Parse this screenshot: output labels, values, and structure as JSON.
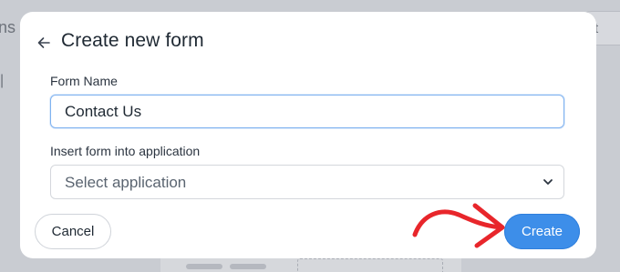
{
  "background": {
    "left_fragment": "ns",
    "pipe": "|",
    "right_fragment": "rt"
  },
  "modal": {
    "title": "Create new form",
    "form_name_label": "Form Name",
    "form_name_value": "Contact Us",
    "app_label": "Insert form into application",
    "app_select_value": "Select application",
    "cancel_label": "Cancel",
    "create_label": "Create"
  },
  "icons": {
    "back": "arrow-left-icon",
    "chevron": "chevron-down-icon",
    "annotation": "red-arrow-icon"
  },
  "colors": {
    "accent": "#3d8ee9",
    "annotation": "#e8262b",
    "overlay": "#c9ccd2"
  }
}
